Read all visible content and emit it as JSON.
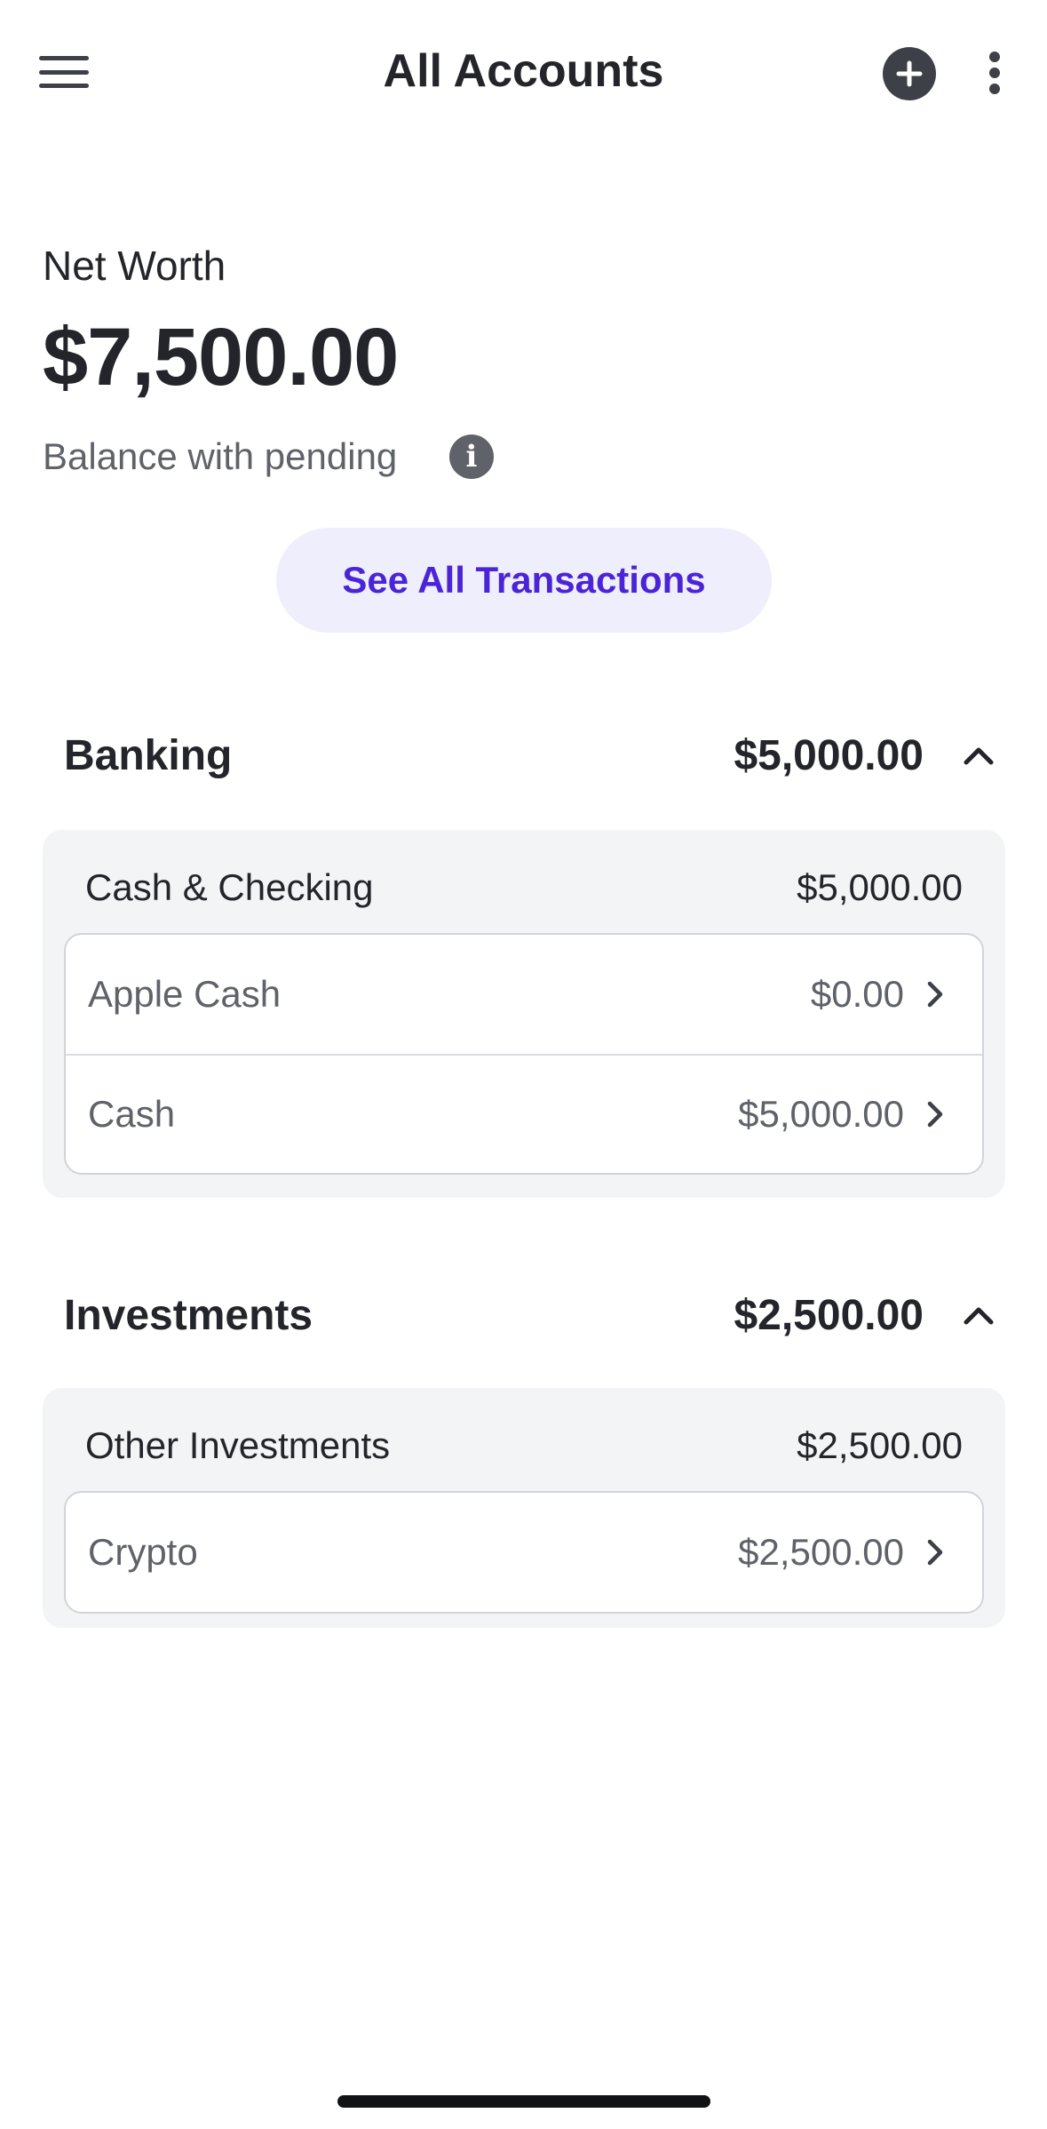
{
  "header": {
    "title": "All Accounts",
    "menu_icon": "hamburger-menu-icon",
    "add_icon": "plus-circle-icon",
    "more_icon": "more-vertical-icon"
  },
  "net_worth": {
    "label": "Net Worth",
    "value": "$7,500.00",
    "subtitle": "Balance with pending",
    "info_icon": "info-icon"
  },
  "see_all_button": "See All Transactions",
  "colors": {
    "accent": "#4a24d6",
    "accent_bg": "#efeefc",
    "panel_bg": "#f3f4f6",
    "text": "#24252a",
    "muted": "#5f6269"
  },
  "groups": [
    {
      "name": "Banking",
      "total": "$5,000.00",
      "expanded": true,
      "subgroup": {
        "name": "Cash & Checking",
        "total": "$5,000.00",
        "accounts": [
          {
            "name": "Apple Cash",
            "amount": "$0.00"
          },
          {
            "name": "Cash",
            "amount": "$5,000.00"
          }
        ]
      }
    },
    {
      "name": "Investments",
      "total": "$2,500.00",
      "expanded": true,
      "subgroup": {
        "name": "Other Investments",
        "total": "$2,500.00",
        "accounts": [
          {
            "name": "Crypto",
            "amount": "$2,500.00"
          }
        ]
      }
    }
  ]
}
